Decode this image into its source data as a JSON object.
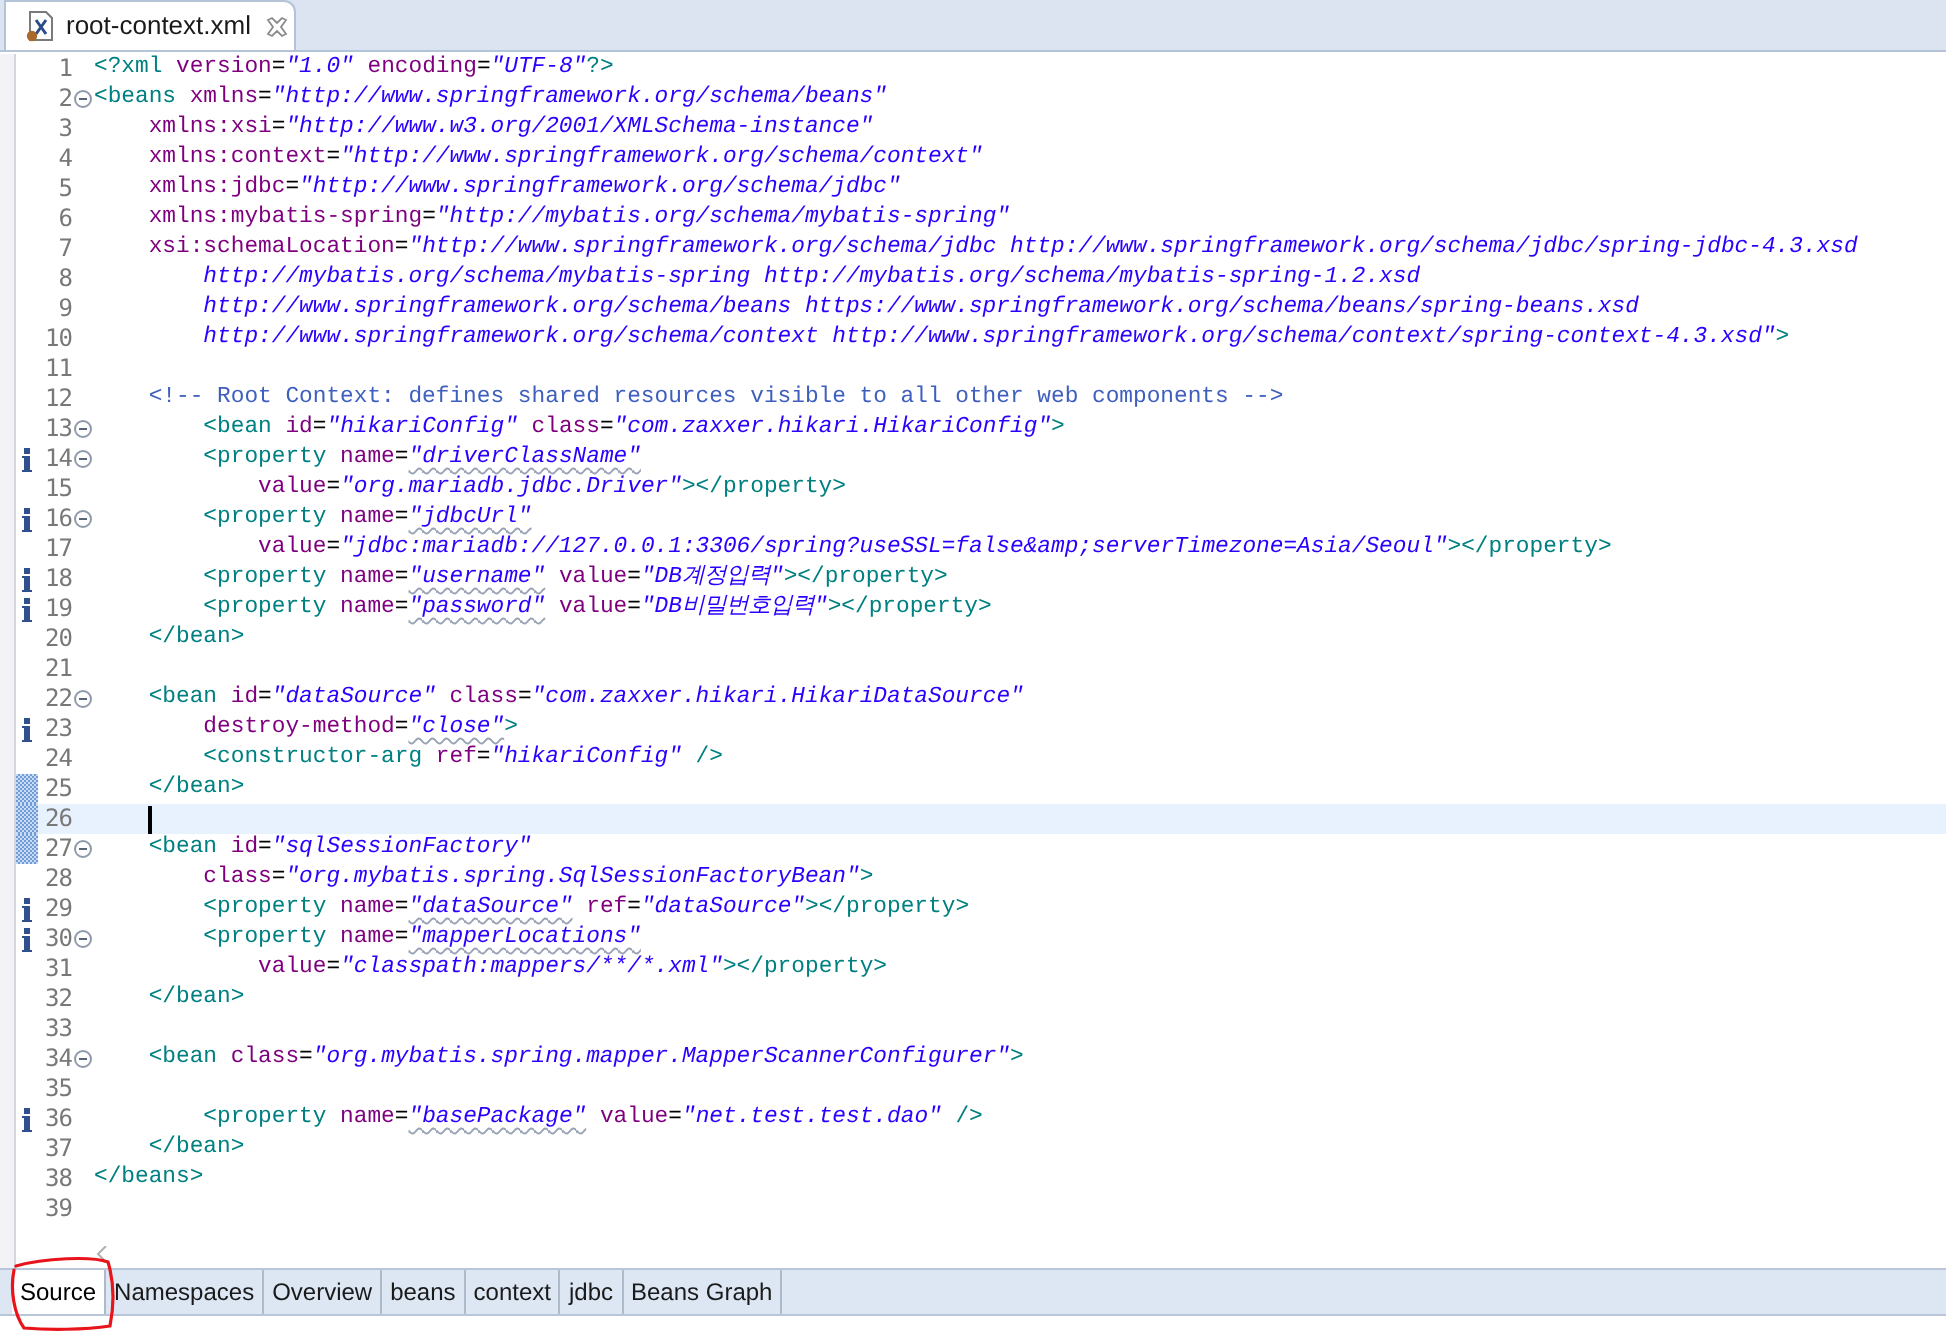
{
  "editor_tab": {
    "title": "root-context.xml",
    "selected": true
  },
  "lines": [
    {
      "number": "1",
      "tokens": [
        {
          "kind": "tag",
          "text": "<?xml"
        },
        {
          "kind": "attr",
          "text": " version"
        },
        {
          "kind": "eq",
          "text": "="
        },
        {
          "kind": "str",
          "text": "\"1.0\""
        },
        {
          "kind": "attr",
          "text": " encoding"
        },
        {
          "kind": "eq",
          "text": "="
        },
        {
          "kind": "str",
          "text": "\"UTF-8\""
        },
        {
          "kind": "tag",
          "text": "?>"
        }
      ]
    },
    {
      "number": "2",
      "foldable": true,
      "tokens": [
        {
          "kind": "tag",
          "text": "<beans"
        },
        {
          "kind": "attr",
          "text": " xmlns"
        },
        {
          "kind": "eq",
          "text": "="
        },
        {
          "kind": "str",
          "text": "\"http://www.springframework.org/schema/beans\""
        }
      ]
    },
    {
      "number": "3",
      "tokens": [
        {
          "kind": "attr",
          "text": "    xmlns:xsi"
        },
        {
          "kind": "eq",
          "text": "="
        },
        {
          "kind": "str",
          "text": "\"http://www.w3.org/2001/XMLSchema-instance\""
        }
      ]
    },
    {
      "number": "4",
      "tokens": [
        {
          "kind": "attr",
          "text": "    xmlns:context"
        },
        {
          "kind": "eq",
          "text": "="
        },
        {
          "kind": "str",
          "text": "\"http://www.springframework.org/schema/context\""
        }
      ]
    },
    {
      "number": "5",
      "tokens": [
        {
          "kind": "attr",
          "text": "    xmlns:jdbc"
        },
        {
          "kind": "eq",
          "text": "="
        },
        {
          "kind": "str",
          "text": "\"http://www.springframework.org/schema/jdbc\""
        }
      ]
    },
    {
      "number": "6",
      "tokens": [
        {
          "kind": "attr",
          "text": "    xmlns:mybatis-spring"
        },
        {
          "kind": "eq",
          "text": "="
        },
        {
          "kind": "str",
          "text": "\"http://mybatis.org/schema/mybatis-spring\""
        }
      ]
    },
    {
      "number": "7",
      "tokens": [
        {
          "kind": "attr",
          "text": "    xsi:schemaLocation"
        },
        {
          "kind": "eq",
          "text": "="
        },
        {
          "kind": "str",
          "text": "\"http://www.springframework.org/schema/jdbc http://www.springframework.org/schema/jdbc/spring-jdbc-4.3.xsd"
        }
      ]
    },
    {
      "number": "8",
      "tokens": [
        {
          "kind": "str",
          "text": "        http://mybatis.org/schema/mybatis-spring http://mybatis.org/schema/mybatis-spring-1.2.xsd"
        }
      ]
    },
    {
      "number": "9",
      "tokens": [
        {
          "kind": "str",
          "text": "        http://www.springframework.org/schema/beans https://www.springframework.org/schema/beans/spring-beans.xsd"
        }
      ]
    },
    {
      "number": "10",
      "tokens": [
        {
          "kind": "str",
          "text": "        http://www.springframework.org/schema/context http://www.springframework.org/schema/context/spring-context-4.3.xsd\""
        },
        {
          "kind": "tag",
          "text": ">"
        }
      ]
    },
    {
      "number": "11"
    },
    {
      "number": "12",
      "tokens": [
        {
          "kind": "comment",
          "text": "    <!-- Root Context: defines shared resources visible to all other web components -->"
        }
      ]
    },
    {
      "number": "13",
      "foldable": true,
      "tokens": [
        {
          "kind": "tag",
          "text": "        <bean"
        },
        {
          "kind": "attr",
          "text": " id"
        },
        {
          "kind": "eq",
          "text": "="
        },
        {
          "kind": "str",
          "text": "\"hikariConfig\""
        },
        {
          "kind": "attr",
          "text": " class"
        },
        {
          "kind": "eq",
          "text": "="
        },
        {
          "kind": "str",
          "text": "\"com.zaxxer.hikari.HikariConfig\""
        },
        {
          "kind": "tag",
          "text": ">"
        }
      ]
    },
    {
      "number": "14",
      "info": true,
      "foldable": true,
      "tokens": [
        {
          "kind": "tag",
          "text": "        <property"
        },
        {
          "kind": "attr",
          "text": " name"
        },
        {
          "kind": "eq",
          "text": "="
        },
        {
          "kind": "flagged",
          "text": "\"driverClassName\""
        }
      ]
    },
    {
      "number": "15",
      "tokens": [
        {
          "kind": "attr",
          "text": "            value"
        },
        {
          "kind": "eq",
          "text": "="
        },
        {
          "kind": "str",
          "text": "\"org.mariadb.jdbc.Driver\""
        },
        {
          "kind": "tag",
          "text": "></property>"
        }
      ]
    },
    {
      "number": "16",
      "info": true,
      "foldable": true,
      "tokens": [
        {
          "kind": "tag",
          "text": "        <property"
        },
        {
          "kind": "attr",
          "text": " name"
        },
        {
          "kind": "eq",
          "text": "="
        },
        {
          "kind": "flagged",
          "text": "\"jdbcUrl\""
        }
      ]
    },
    {
      "number": "17",
      "tokens": [
        {
          "kind": "attr",
          "text": "            value"
        },
        {
          "kind": "eq",
          "text": "="
        },
        {
          "kind": "str",
          "text": "\"jdbc:mariadb://127.0.0.1:3306/spring?useSSL=false&amp;serverTimezone=Asia/Seoul\""
        },
        {
          "kind": "tag",
          "text": "></property>"
        }
      ]
    },
    {
      "number": "18",
      "info": true,
      "tokens": [
        {
          "kind": "tag",
          "text": "        <property"
        },
        {
          "kind": "attr",
          "text": " name"
        },
        {
          "kind": "eq",
          "text": "="
        },
        {
          "kind": "flagged",
          "text": "\"username\""
        },
        {
          "kind": "attr",
          "text": " value"
        },
        {
          "kind": "eq",
          "text": "="
        },
        {
          "kind": "str",
          "text": "\"DB계정입력\""
        },
        {
          "kind": "tag",
          "text": "></property>"
        }
      ]
    },
    {
      "number": "19",
      "info": true,
      "tokens": [
        {
          "kind": "tag",
          "text": "        <property"
        },
        {
          "kind": "attr",
          "text": " name"
        },
        {
          "kind": "eq",
          "text": "="
        },
        {
          "kind": "flagged",
          "text": "\"password\""
        },
        {
          "kind": "attr",
          "text": " value"
        },
        {
          "kind": "eq",
          "text": "="
        },
        {
          "kind": "str",
          "text": "\"DB비밀번호입력\""
        },
        {
          "kind": "tag",
          "text": "></property>"
        }
      ]
    },
    {
      "number": "20",
      "tokens": [
        {
          "kind": "tag",
          "text": "    </bean>"
        }
      ]
    },
    {
      "number": "21"
    },
    {
      "number": "22",
      "foldable": true,
      "tokens": [
        {
          "kind": "tag",
          "text": "    <bean"
        },
        {
          "kind": "attr",
          "text": " id"
        },
        {
          "kind": "eq",
          "text": "="
        },
        {
          "kind": "str",
          "text": "\"dataSource\""
        },
        {
          "kind": "attr",
          "text": " class"
        },
        {
          "kind": "eq",
          "text": "="
        },
        {
          "kind": "str",
          "text": "\"com.zaxxer.hikari.HikariDataSource\""
        }
      ]
    },
    {
      "number": "23",
      "info": true,
      "tokens": [
        {
          "kind": "attr",
          "text": "        destroy-method"
        },
        {
          "kind": "eq",
          "text": "="
        },
        {
          "kind": "flagged",
          "text": "\"close\""
        },
        {
          "kind": "tag",
          "text": ">"
        }
      ]
    },
    {
      "number": "24",
      "tokens": [
        {
          "kind": "tag",
          "text": "        <constructor-arg"
        },
        {
          "kind": "attr",
          "text": " ref"
        },
        {
          "kind": "eq",
          "text": "="
        },
        {
          "kind": "str",
          "text": "\"hikariConfig\""
        },
        {
          "kind": "tag",
          "text": " />"
        }
      ]
    },
    {
      "number": "25",
      "changed": true,
      "tokens": [
        {
          "kind": "tag",
          "text": "    </bean>"
        }
      ]
    },
    {
      "number": "26",
      "changed": true,
      "current": true,
      "caret": true
    },
    {
      "number": "27",
      "changed": true,
      "foldable": true,
      "tokens": [
        {
          "kind": "tag",
          "text": "    <bean"
        },
        {
          "kind": "attr",
          "text": " id"
        },
        {
          "kind": "eq",
          "text": "="
        },
        {
          "kind": "str",
          "text": "\"sqlSessionFactory\""
        }
      ]
    },
    {
      "number": "28",
      "tokens": [
        {
          "kind": "attr",
          "text": "        class"
        },
        {
          "kind": "eq",
          "text": "="
        },
        {
          "kind": "str",
          "text": "\"org.mybatis.spring.SqlSessionFactoryBean\""
        },
        {
          "kind": "tag",
          "text": ">"
        }
      ]
    },
    {
      "number": "29",
      "info": true,
      "tokens": [
        {
          "kind": "tag",
          "text": "        <property"
        },
        {
          "kind": "attr",
          "text": " name"
        },
        {
          "kind": "eq",
          "text": "="
        },
        {
          "kind": "flagged",
          "text": "\"dataSource\""
        },
        {
          "kind": "attr",
          "text": " ref"
        },
        {
          "kind": "eq",
          "text": "="
        },
        {
          "kind": "str",
          "text": "\"dataSource\""
        },
        {
          "kind": "tag",
          "text": "></property>"
        }
      ]
    },
    {
      "number": "30",
      "info": true,
      "foldable": true,
      "tokens": [
        {
          "kind": "tag",
          "text": "        <property"
        },
        {
          "kind": "attr",
          "text": " name"
        },
        {
          "kind": "eq",
          "text": "="
        },
        {
          "kind": "flagged",
          "text": "\"mapperLocations\""
        }
      ]
    },
    {
      "number": "31",
      "tokens": [
        {
          "kind": "attr",
          "text": "            value"
        },
        {
          "kind": "eq",
          "text": "="
        },
        {
          "kind": "str",
          "text": "\"classpath:mappers/**/*.xml\""
        },
        {
          "kind": "tag",
          "text": "></property>"
        }
      ]
    },
    {
      "number": "32",
      "tokens": [
        {
          "kind": "tag",
          "text": "    </bean>"
        }
      ]
    },
    {
      "number": "33"
    },
    {
      "number": "34",
      "foldable": true,
      "tokens": [
        {
          "kind": "tag",
          "text": "    <bean"
        },
        {
          "kind": "attr",
          "text": " class"
        },
        {
          "kind": "eq",
          "text": "="
        },
        {
          "kind": "str",
          "text": "\"org.mybatis.spring.mapper.MapperScannerConfigurer\""
        },
        {
          "kind": "tag",
          "text": ">"
        }
      ]
    },
    {
      "number": "35"
    },
    {
      "number": "36",
      "info": true,
      "tokens": [
        {
          "kind": "tag",
          "text": "        <property"
        },
        {
          "kind": "attr",
          "text": " name"
        },
        {
          "kind": "eq",
          "text": "="
        },
        {
          "kind": "flagged",
          "text": "\"basePackage\""
        },
        {
          "kind": "attr",
          "text": " value"
        },
        {
          "kind": "eq",
          "text": "="
        },
        {
          "kind": "str",
          "text": "\"net.test.test.dao\""
        },
        {
          "kind": "tag",
          "text": " />"
        }
      ]
    },
    {
      "number": "37",
      "tokens": [
        {
          "kind": "tag",
          "text": "    </bean>"
        }
      ]
    },
    {
      "number": "38",
      "tokens": [
        {
          "kind": "tag",
          "text": "</beans>"
        }
      ]
    },
    {
      "number": "39"
    }
  ],
  "page_tabs": [
    {
      "label": "Source",
      "selected": true
    },
    {
      "label": "Namespaces",
      "selected": false
    },
    {
      "label": "Overview",
      "selected": false
    },
    {
      "label": "beans",
      "selected": false
    },
    {
      "label": "context",
      "selected": false
    },
    {
      "label": "jdbc",
      "selected": false
    },
    {
      "label": "Beans Graph",
      "selected": false
    }
  ],
  "annotation": {
    "kind": "freehand-circle"
  }
}
